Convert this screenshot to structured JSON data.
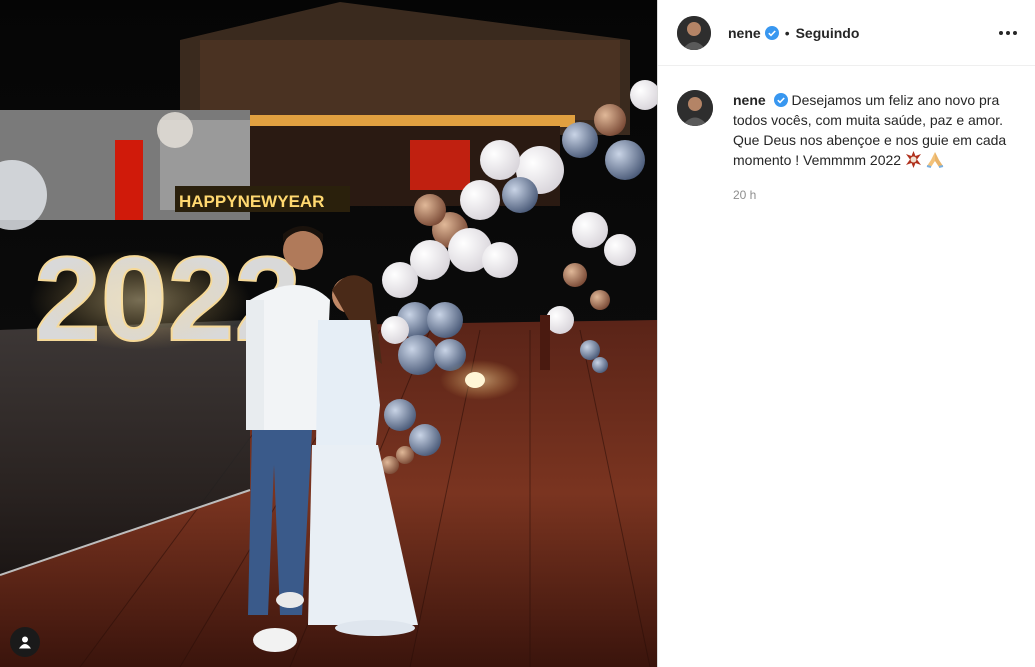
{
  "post": {
    "username": "nene",
    "verified": true,
    "separator": "•",
    "follow_status": "Seguindo",
    "caption": {
      "line1": "Desejamos um feliz ano novo pra todos vocês, com muita saúde, paz e amor.",
      "line2": "Que Deus nos abençoe e nos guie em cada momento ! Vemmmm 2022"
    },
    "timestamp": "20 h"
  },
  "photo_text": {
    "banner": "HAPPYNEWYEAR",
    "year": "2022"
  },
  "colors": {
    "verified_blue": "#3897f0",
    "text": "#262626",
    "muted": "#8e8e8e",
    "border": "#dbdbdb"
  }
}
